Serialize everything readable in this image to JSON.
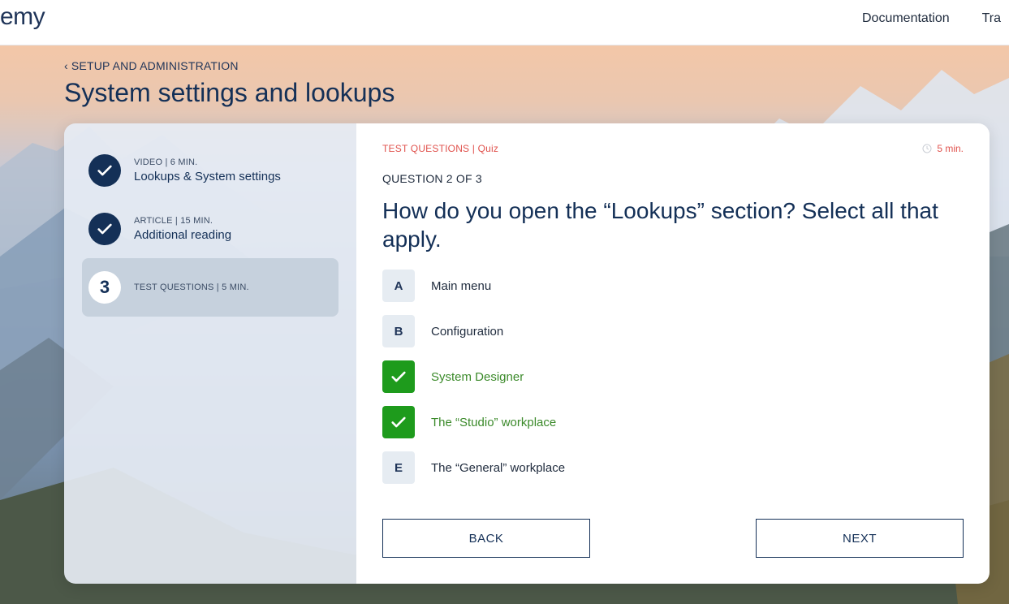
{
  "header": {
    "logo_text": "emy",
    "nav": [
      "Documentation",
      "Tra"
    ]
  },
  "page": {
    "breadcrumb": "SETUP AND ADMINISTRATION",
    "title": "System settings and lookups"
  },
  "sidebar": {
    "steps": [
      {
        "meta": "VIDEO | 6 MIN.",
        "title": "Lookups & System settings",
        "status": "done"
      },
      {
        "meta": "ARTICLE | 15 MIN.",
        "title": "Additional reading",
        "status": "done"
      },
      {
        "number": "3",
        "meta": "TEST QUESTIONS | 5 MIN.",
        "title": "",
        "status": "active"
      }
    ]
  },
  "quiz": {
    "meta": "TEST QUESTIONS | Quiz",
    "timer": "5 min.",
    "counter": "QUESTION 2 OF 3",
    "question": "How do you open the “Lookups” section? Select all that apply.",
    "options": [
      {
        "key": "A",
        "label": "Main menu",
        "checked": false
      },
      {
        "key": "B",
        "label": "Configuration",
        "checked": false
      },
      {
        "key": "C",
        "label": "System Designer",
        "checked": true
      },
      {
        "key": "D",
        "label": "The “Studio” workplace",
        "checked": true
      },
      {
        "key": "E",
        "label": "The “General” workplace",
        "checked": false
      }
    ],
    "back_label": "BACK",
    "next_label": "NEXT"
  },
  "colors": {
    "brand": "#143057",
    "accent_red": "#e0524d",
    "checked_green": "#1e9b1c"
  }
}
